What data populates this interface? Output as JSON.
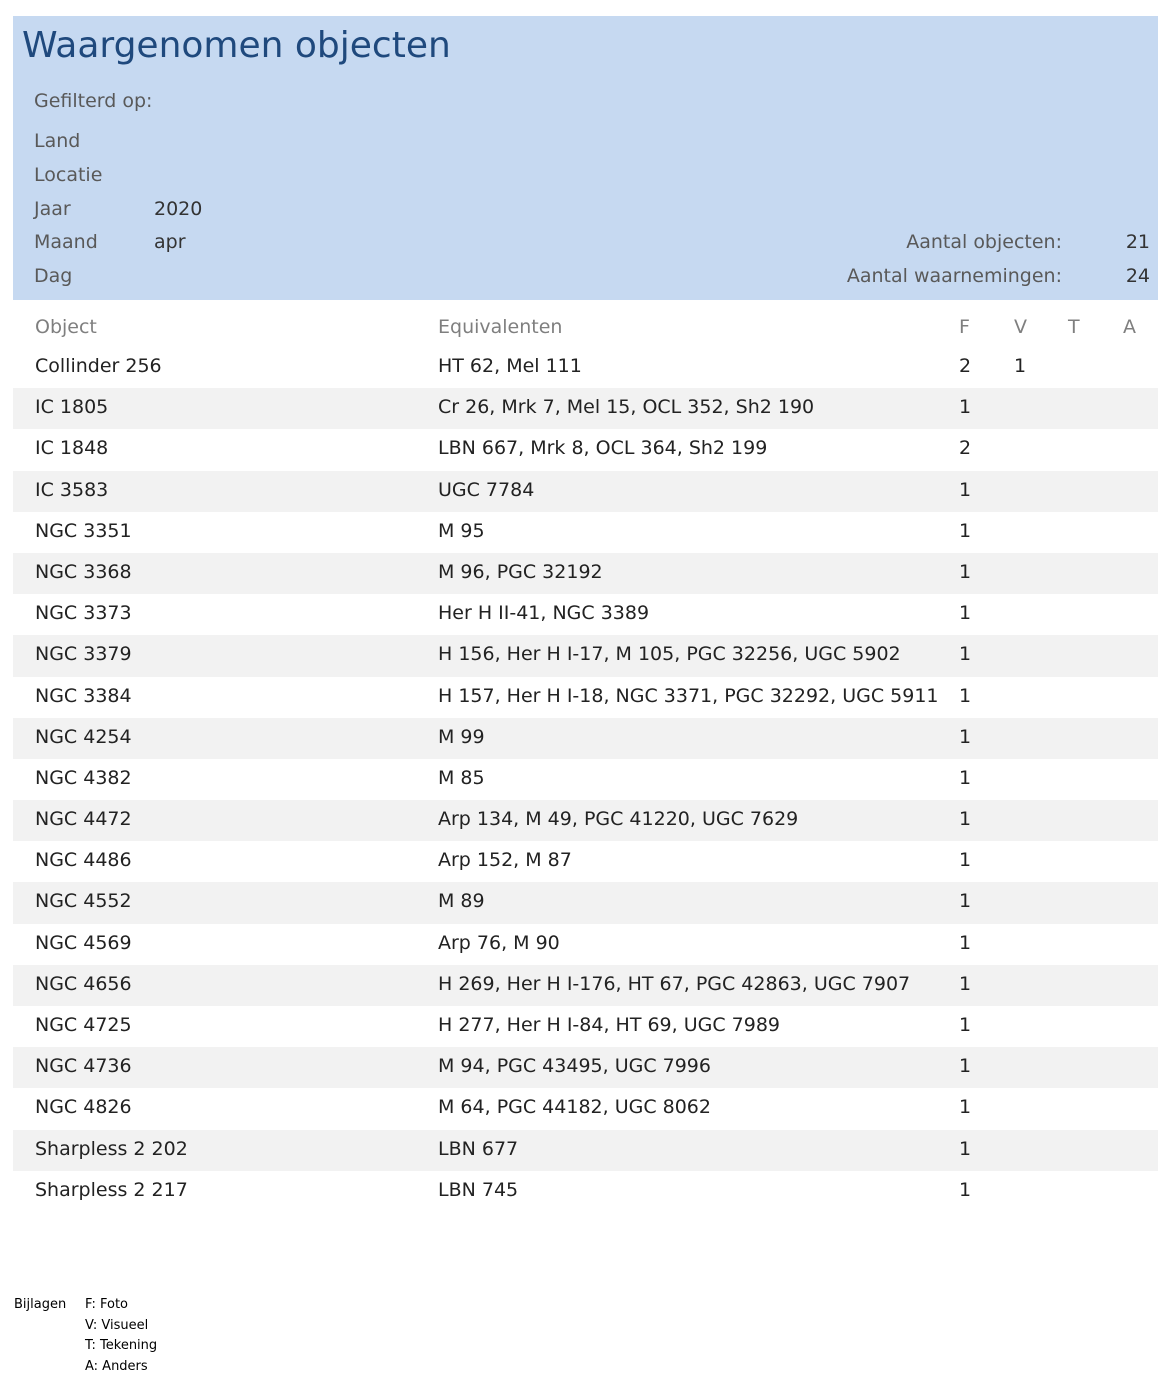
{
  "header": {
    "title": "Waargenomen objecten",
    "filter_label": "Gefilterd op:",
    "filters": [
      {
        "key": "Land",
        "value": ""
      },
      {
        "key": "Locatie",
        "value": ""
      },
      {
        "key": "Jaar",
        "value": "2020"
      },
      {
        "key": "Maand",
        "value": "apr"
      },
      {
        "key": "Dag",
        "value": ""
      }
    ],
    "stats": [
      {
        "label": "Aantal objecten:",
        "value": "21"
      },
      {
        "label": "Aantal waarnemingen:",
        "value": "24"
      }
    ]
  },
  "table": {
    "columns": {
      "object": "Object",
      "equivalents": "Equivalenten",
      "f": "F",
      "v": "V",
      "t": "T",
      "a": "A"
    },
    "rows": [
      {
        "object": "Collinder 256",
        "equivalents": "HT 62, Mel 111",
        "f": "2",
        "v": "1",
        "t": "",
        "a": ""
      },
      {
        "object": "IC 1805",
        "equivalents": "Cr 26, Mrk 7, Mel 15, OCL 352, Sh2 190",
        "f": "1",
        "v": "",
        "t": "",
        "a": ""
      },
      {
        "object": "IC 1848",
        "equivalents": "LBN 667, Mrk 8, OCL 364, Sh2 199",
        "f": "2",
        "v": "",
        "t": "",
        "a": ""
      },
      {
        "object": "IC 3583",
        "equivalents": "UGC 7784",
        "f": "1",
        "v": "",
        "t": "",
        "a": ""
      },
      {
        "object": "NGC 3351",
        "equivalents": "M 95",
        "f": "1",
        "v": "",
        "t": "",
        "a": ""
      },
      {
        "object": "NGC 3368",
        "equivalents": "M 96, PGC 32192",
        "f": "1",
        "v": "",
        "t": "",
        "a": ""
      },
      {
        "object": "NGC 3373",
        "equivalents": "Her H II-41, NGC 3389",
        "f": "1",
        "v": "",
        "t": "",
        "a": ""
      },
      {
        "object": "NGC 3379",
        "equivalents": "H 156, Her H I-17, M 105, PGC 32256, UGC 5902",
        "f": "1",
        "v": "",
        "t": "",
        "a": ""
      },
      {
        "object": "NGC 3384",
        "equivalents": "H 157, Her H I-18, NGC 3371, PGC 32292, UGC 5911",
        "f": "1",
        "v": "",
        "t": "",
        "a": ""
      },
      {
        "object": "NGC 4254",
        "equivalents": "M 99",
        "f": "1",
        "v": "",
        "t": "",
        "a": ""
      },
      {
        "object": "NGC 4382",
        "equivalents": "M 85",
        "f": "1",
        "v": "",
        "t": "",
        "a": ""
      },
      {
        "object": "NGC 4472",
        "equivalents": "Arp 134, M 49, PGC 41220, UGC 7629",
        "f": "1",
        "v": "",
        "t": "",
        "a": ""
      },
      {
        "object": "NGC 4486",
        "equivalents": "Arp 152, M 87",
        "f": "1",
        "v": "",
        "t": "",
        "a": ""
      },
      {
        "object": "NGC 4552",
        "equivalents": "M 89",
        "f": "1",
        "v": "",
        "t": "",
        "a": ""
      },
      {
        "object": "NGC 4569",
        "equivalents": "Arp 76, M 90",
        "f": "1",
        "v": "",
        "t": "",
        "a": ""
      },
      {
        "object": "NGC 4656",
        "equivalents": "H 269, Her H I-176, HT 67, PGC 42863, UGC 7907",
        "f": "1",
        "v": "",
        "t": "",
        "a": ""
      },
      {
        "object": "NGC 4725",
        "equivalents": "H 277, Her H I-84, HT 69, UGC 7989",
        "f": "1",
        "v": "",
        "t": "",
        "a": ""
      },
      {
        "object": "NGC 4736",
        "equivalents": "M 94, PGC 43495, UGC 7996",
        "f": "1",
        "v": "",
        "t": "",
        "a": ""
      },
      {
        "object": "NGC 4826",
        "equivalents": "M 64, PGC 44182, UGC 8062",
        "f": "1",
        "v": "",
        "t": "",
        "a": ""
      },
      {
        "object": "Sharpless 2 202",
        "equivalents": "LBN 677",
        "f": "1",
        "v": "",
        "t": "",
        "a": ""
      },
      {
        "object": "Sharpless 2 217",
        "equivalents": "LBN 745",
        "f": "1",
        "v": "",
        "t": "",
        "a": ""
      }
    ]
  },
  "legend": {
    "title": "Bijlagen",
    "items": [
      "F: Foto",
      "V: Visueel",
      "T: Tekening",
      "A: Anders"
    ]
  }
}
